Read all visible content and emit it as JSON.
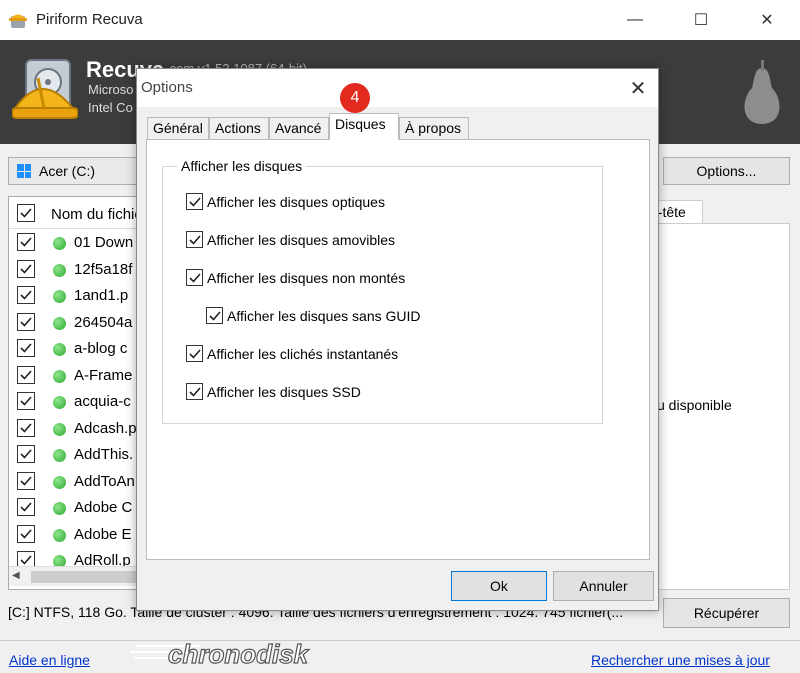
{
  "window": {
    "title": "Piriform Recuva",
    "minimize": "—",
    "maximize": "☐",
    "close": "✕"
  },
  "header": {
    "app_name": "Recuva",
    "version": ".com v1.53.1087 (64-bit)",
    "sys_line1": "Microso",
    "sys_line2": "Intel Co"
  },
  "toolbar": {
    "drive": "Acer (C:)",
    "options_label": "Options..."
  },
  "file_list": {
    "column_header": "Nom du fichier",
    "rows": [
      "01 Down",
      "12f5a18f",
      "1and1.p",
      "264504a",
      "a-blog c",
      "A-Frame",
      "acquia-c",
      "Adcash.p",
      "AddThis.",
      "AddToAn",
      "Adobe C",
      "Adobe E",
      "AdRoll.p"
    ],
    "status_color": "#2fa82f"
  },
  "right_pane": {
    "tab_label": "n-tête",
    "preview_text": "çu disponible"
  },
  "status_bar": {
    "text": "[C:] NTFS, 118 Go. Taille de cluster : 4096. Taille des fichiers d'enregistrement : 1024. 745 fichier(...",
    "recover_label": "Récupérer"
  },
  "footer": {
    "help_link": "Aide en ligne",
    "update_link": "Rechercher une mises à jour",
    "watermark": "chronodisk"
  },
  "dialog": {
    "title": "Options",
    "close": "✕",
    "tabs": [
      "Général",
      "Actions",
      "Avancé",
      "Disques",
      "À propos"
    ],
    "active_tab": "Disques",
    "step_badge": "4",
    "badge_color": "#e32a1f",
    "group_title": "Afficher les disques",
    "options": [
      {
        "label": "Afficher les disques optiques",
        "checked": true
      },
      {
        "label": "Afficher les disques amovibles",
        "checked": true
      },
      {
        "label": "Afficher les disques non montés",
        "checked": true
      },
      {
        "label": "Afficher les disques sans GUID",
        "checked": true
      },
      {
        "label": "Afficher les clichés instantanés",
        "checked": true
      },
      {
        "label": "Afficher les disques SSD",
        "checked": true
      }
    ],
    "ok_label": "Ok",
    "cancel_label": "Annuler"
  }
}
